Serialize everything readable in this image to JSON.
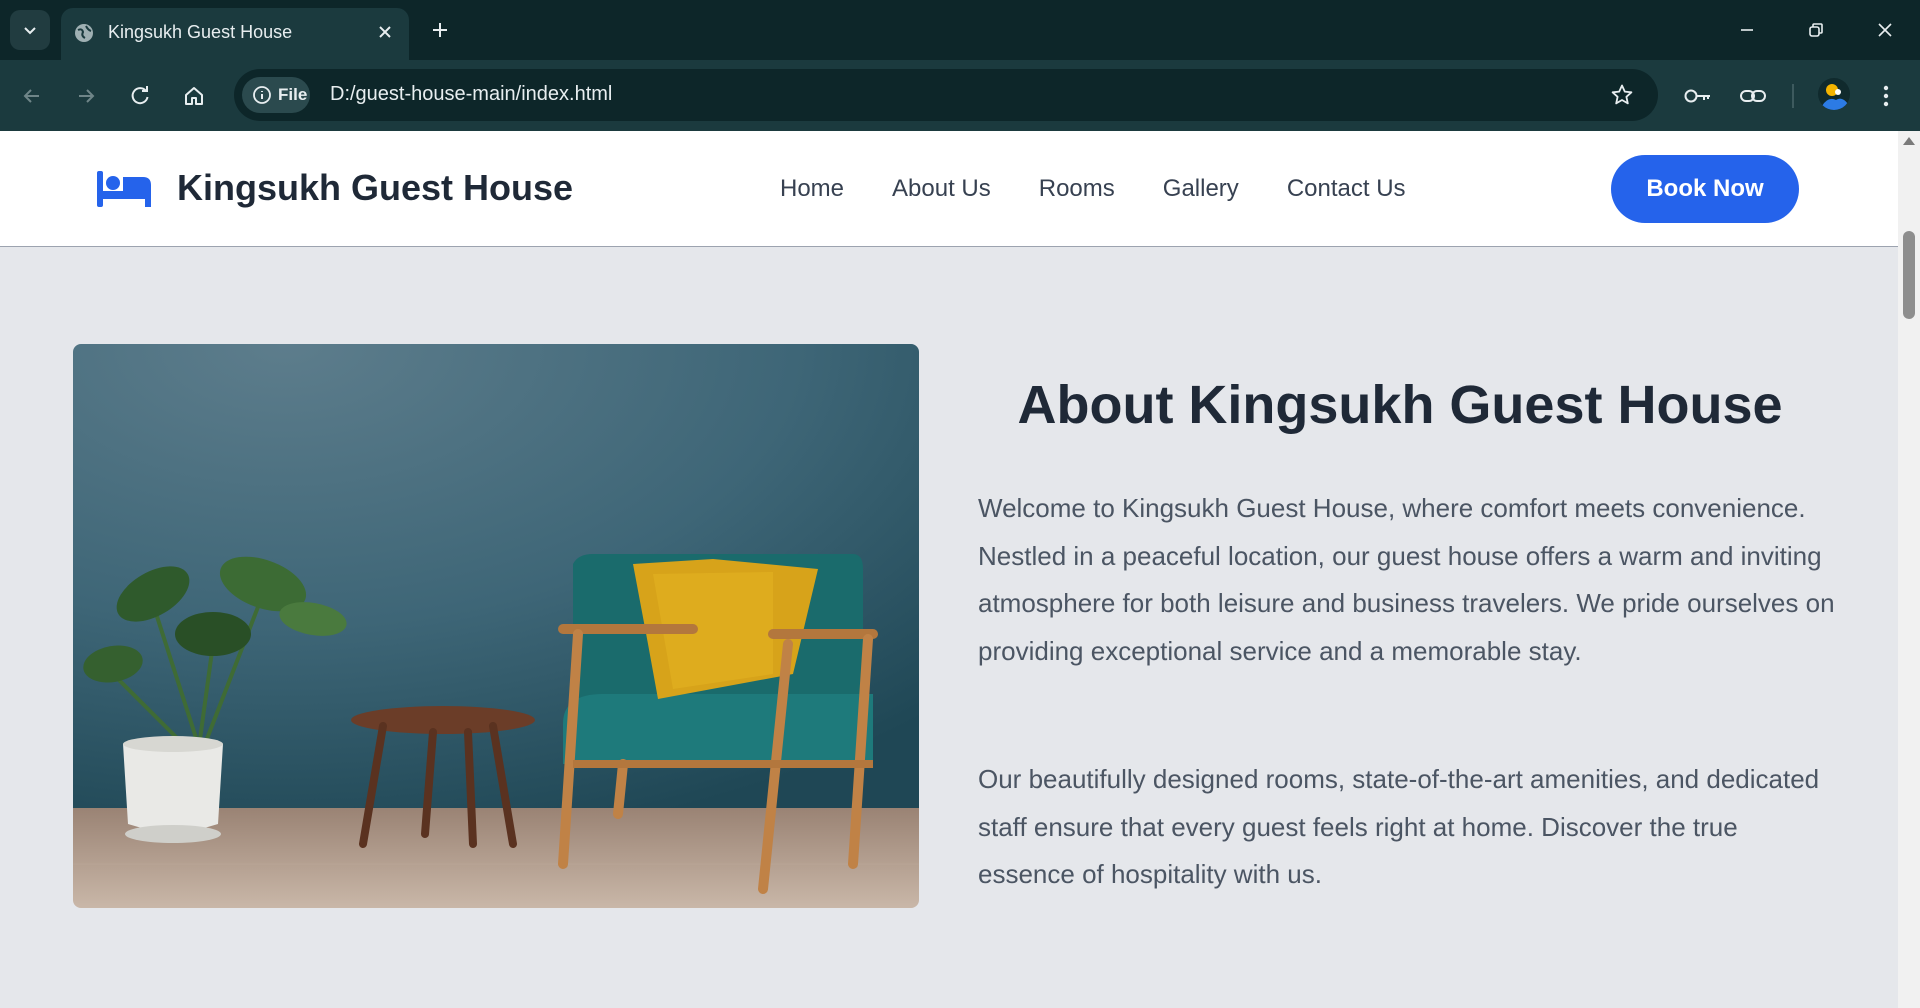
{
  "browser": {
    "tab_title": "Kingsukh Guest House",
    "security_chip": "File",
    "url": "D:/guest-house-main/index.html"
  },
  "site": {
    "brand": "Kingsukh Guest House",
    "nav": [
      "Home",
      "About Us",
      "Rooms",
      "Gallery",
      "Contact Us"
    ],
    "cta": "Book Now",
    "accent_color": "#2563eb"
  },
  "about": {
    "title": "About Kingsukh Guest House",
    "paragraphs": [
      "Welcome to Kingsukh Guest House, where comfort meets convenience. Nestled in a peaceful location, our guest house offers a warm and inviting atmosphere for both leisure and business travelers. We pride ourselves on providing exceptional service and a memorable stay.",
      "Our beautifully designed rooms, state-of-the-art amenities, and dedicated staff ensure that every guest feels right at home. Discover the true essence of hospitality with us."
    ],
    "image_icon": "armchair-room-photo"
  }
}
